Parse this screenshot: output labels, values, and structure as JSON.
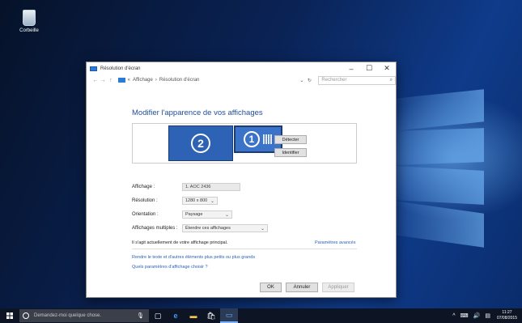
{
  "desktop": {
    "icons": [
      {
        "label": "Corbeille",
        "icon": "recycle-bin-icon"
      }
    ]
  },
  "window": {
    "title": "Résolution d'écran",
    "controls": {
      "minimize": "–",
      "maximize": "☐",
      "close": "✕"
    },
    "address": {
      "back": "←",
      "forward": "→",
      "up": "↑",
      "sep1": "«",
      "crumb1": "Affichage",
      "sep2": "›",
      "crumb2": "Résolution d'écran",
      "dropdown": "⌄",
      "refresh": "↻",
      "search_placeholder": "Rechercher",
      "search_icon": "⌕"
    },
    "heading": "Modifier l'apparence de vos affichages",
    "monitors": [
      {
        "number": "2"
      },
      {
        "number": "1"
      }
    ],
    "buttons": {
      "detect": "Détecter",
      "identify": "Identifier"
    },
    "settings": {
      "display_label": "Affichage :",
      "display_value": "1. AOC 2436",
      "resolution_label": "Résolution :",
      "resolution_value": "1280 x 800",
      "orientation_label": "Orientation :",
      "orientation_value": "Paysage",
      "multiple_label": "Affichages multiples :",
      "multiple_value": "Étendre ces affichages",
      "chevron": "⌄"
    },
    "info_text": "Il s'agit actuellement de votre affichage principal.",
    "advanced_link": "Paramètres avancés",
    "links": [
      "Rendre le texte et d'autres éléments plus petits ou plus grands",
      "Quels paramètres d'affichage choisir ?"
    ],
    "footer": {
      "ok": "OK",
      "cancel": "Annuler",
      "apply": "Appliquer"
    }
  },
  "taskbar": {
    "search_placeholder": "Demandez-moi quelque chose.",
    "mic": "🎙",
    "items": [
      {
        "name": "task-view-icon",
        "glyph": "▢"
      },
      {
        "name": "edge-icon",
        "glyph": "e"
      },
      {
        "name": "file-explorer-icon",
        "glyph": "▬"
      },
      {
        "name": "store-icon",
        "glyph": "🛍"
      },
      {
        "name": "display-settings-icon",
        "glyph": "▭"
      }
    ],
    "tray": {
      "chevron": "^",
      "network": "⌨",
      "volume": "🔊",
      "notif": "▤"
    },
    "time": "11:27",
    "date": "07/08/2015"
  }
}
